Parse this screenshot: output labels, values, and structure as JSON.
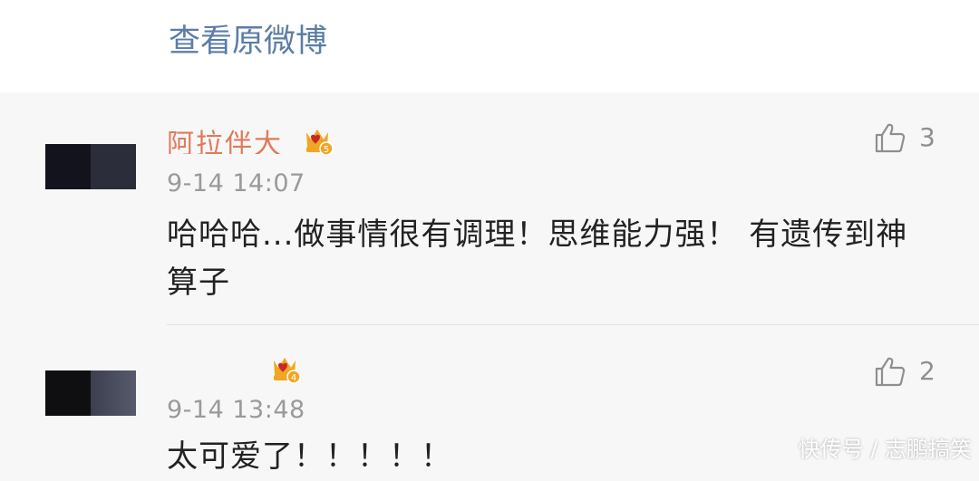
{
  "header": {
    "view_original": "查看原微博"
  },
  "comments": [
    {
      "username": "阿拉伴大",
      "badge_icon": "crown-vip-badge-icon",
      "badge_level": "5",
      "time": "9-14 14:07",
      "text": "哈哈哈...做事情很有调理！思维能力强！ 有遗传到神算子",
      "like_count": "3"
    },
    {
      "username": "",
      "badge_icon": "crown-vip-badge-icon",
      "badge_level": "4",
      "time": "9-14 13:48",
      "text": "太可爱了！！！！！",
      "like_count": "2"
    }
  ],
  "watermark": "快传号 / 志鹏搞笑",
  "colors": {
    "link": "#5b7da6",
    "username": "#e17a5a",
    "badge": "#f0a623"
  }
}
